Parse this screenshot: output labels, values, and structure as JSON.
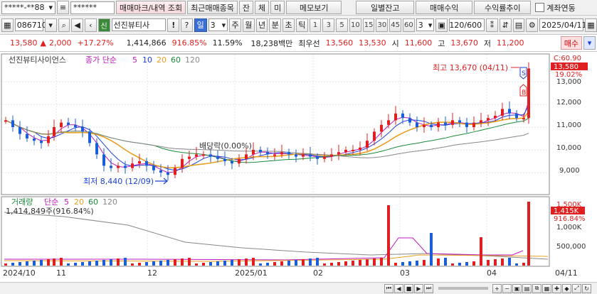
{
  "toolbar1": {
    "account": "*****-**88",
    "password": "******",
    "tab_trade_marks": "매매마크/내역 조회",
    "tab_recent": "최근매매종목",
    "btn_jan": "잔",
    "btn_che": "체",
    "btn_mi": "미",
    "btn_memo": "메모보기",
    "btn_daily_balance": "일별잔고",
    "btn_trade_profit": "매매수익",
    "btn_return_trend": "수익률추이",
    "link_account": "계좌연동"
  },
  "toolbar2": {
    "code": "086710",
    "badge_sin": "신",
    "stock_name": "선진뷰티사",
    "btn_excl": "!",
    "btn_q": "?",
    "period_label": "일",
    "period_value": "3",
    "periods": [
      "주",
      "월",
      "년",
      "분",
      "초",
      "틱"
    ],
    "numbers": [
      "1",
      "3",
      "5",
      "10",
      "15",
      "30",
      "45",
      "60"
    ],
    "minute_select": "3",
    "count": "120/600",
    "date": "2025/04/11"
  },
  "quote": {
    "price": "13,580",
    "change_arrow": "▲",
    "change": "2,000",
    "change_pct": "+17.27%",
    "volume": "1,414,866",
    "vol_ratio": "916.85%",
    "turnover": "11.59%",
    "amount": "18,238백만",
    "priority_label": "최우선",
    "ask": "13,560",
    "bid": "13,530",
    "open_label": "시",
    "open": "11,600",
    "high_label": "고",
    "high": "13,670",
    "low_label": "저",
    "low": "11,200",
    "order_label": "매수"
  },
  "price_panel": {
    "name": "선진뷰티사이언스",
    "ma_label": "종가 단순",
    "ma_periods": [
      "5",
      "10",
      "20",
      "60",
      "120"
    ],
    "ma_colors": [
      "#c01ac0",
      "#1a3fd8",
      "#e8a020",
      "#1a8a3a",
      "#888888"
    ],
    "high_annot": "최고 13,670 (04/11)",
    "low_annot": "최저 8,440 (12/09)",
    "dividend_annot": "배당락(0.00%)",
    "y_ticks": [
      "13,000",
      "12,000",
      "11,000",
      "10,000",
      "9,000"
    ],
    "ratio_label": "C:60.90",
    "price_tag": "13,580",
    "pct_tag": "19.02%",
    "marker_s": "S",
    "marker_b": "B"
  },
  "volume_panel": {
    "label": "거래량",
    "ma_label": "단순",
    "ma_periods": [
      "5",
      "20",
      "60",
      "120"
    ],
    "value": "1,414,849주(916.84%)",
    "y_ticks": [
      "1,500K",
      "1,000K",
      "500,000"
    ],
    "vol_tag": "1,415K",
    "pct_tag": "916.84%"
  },
  "x_axis": [
    "2024/10",
    "11",
    "12",
    "2025/01",
    "02",
    "03",
    "04",
    "04/11"
  ],
  "colors": {
    "up": "#e02020",
    "down": "#1a5fd8",
    "accent": "#e8f0ff"
  },
  "chart_data": {
    "type": "candlestick",
    "price_range": [
      8440,
      13670
    ],
    "last": {
      "open": 11600,
      "high": 13670,
      "low": 11200,
      "close": 13580
    },
    "x_labels": [
      "2024/10",
      "11",
      "12",
      "2025/01",
      "02",
      "03",
      "04",
      "04/11"
    ],
    "volume_last": 1414849
  }
}
